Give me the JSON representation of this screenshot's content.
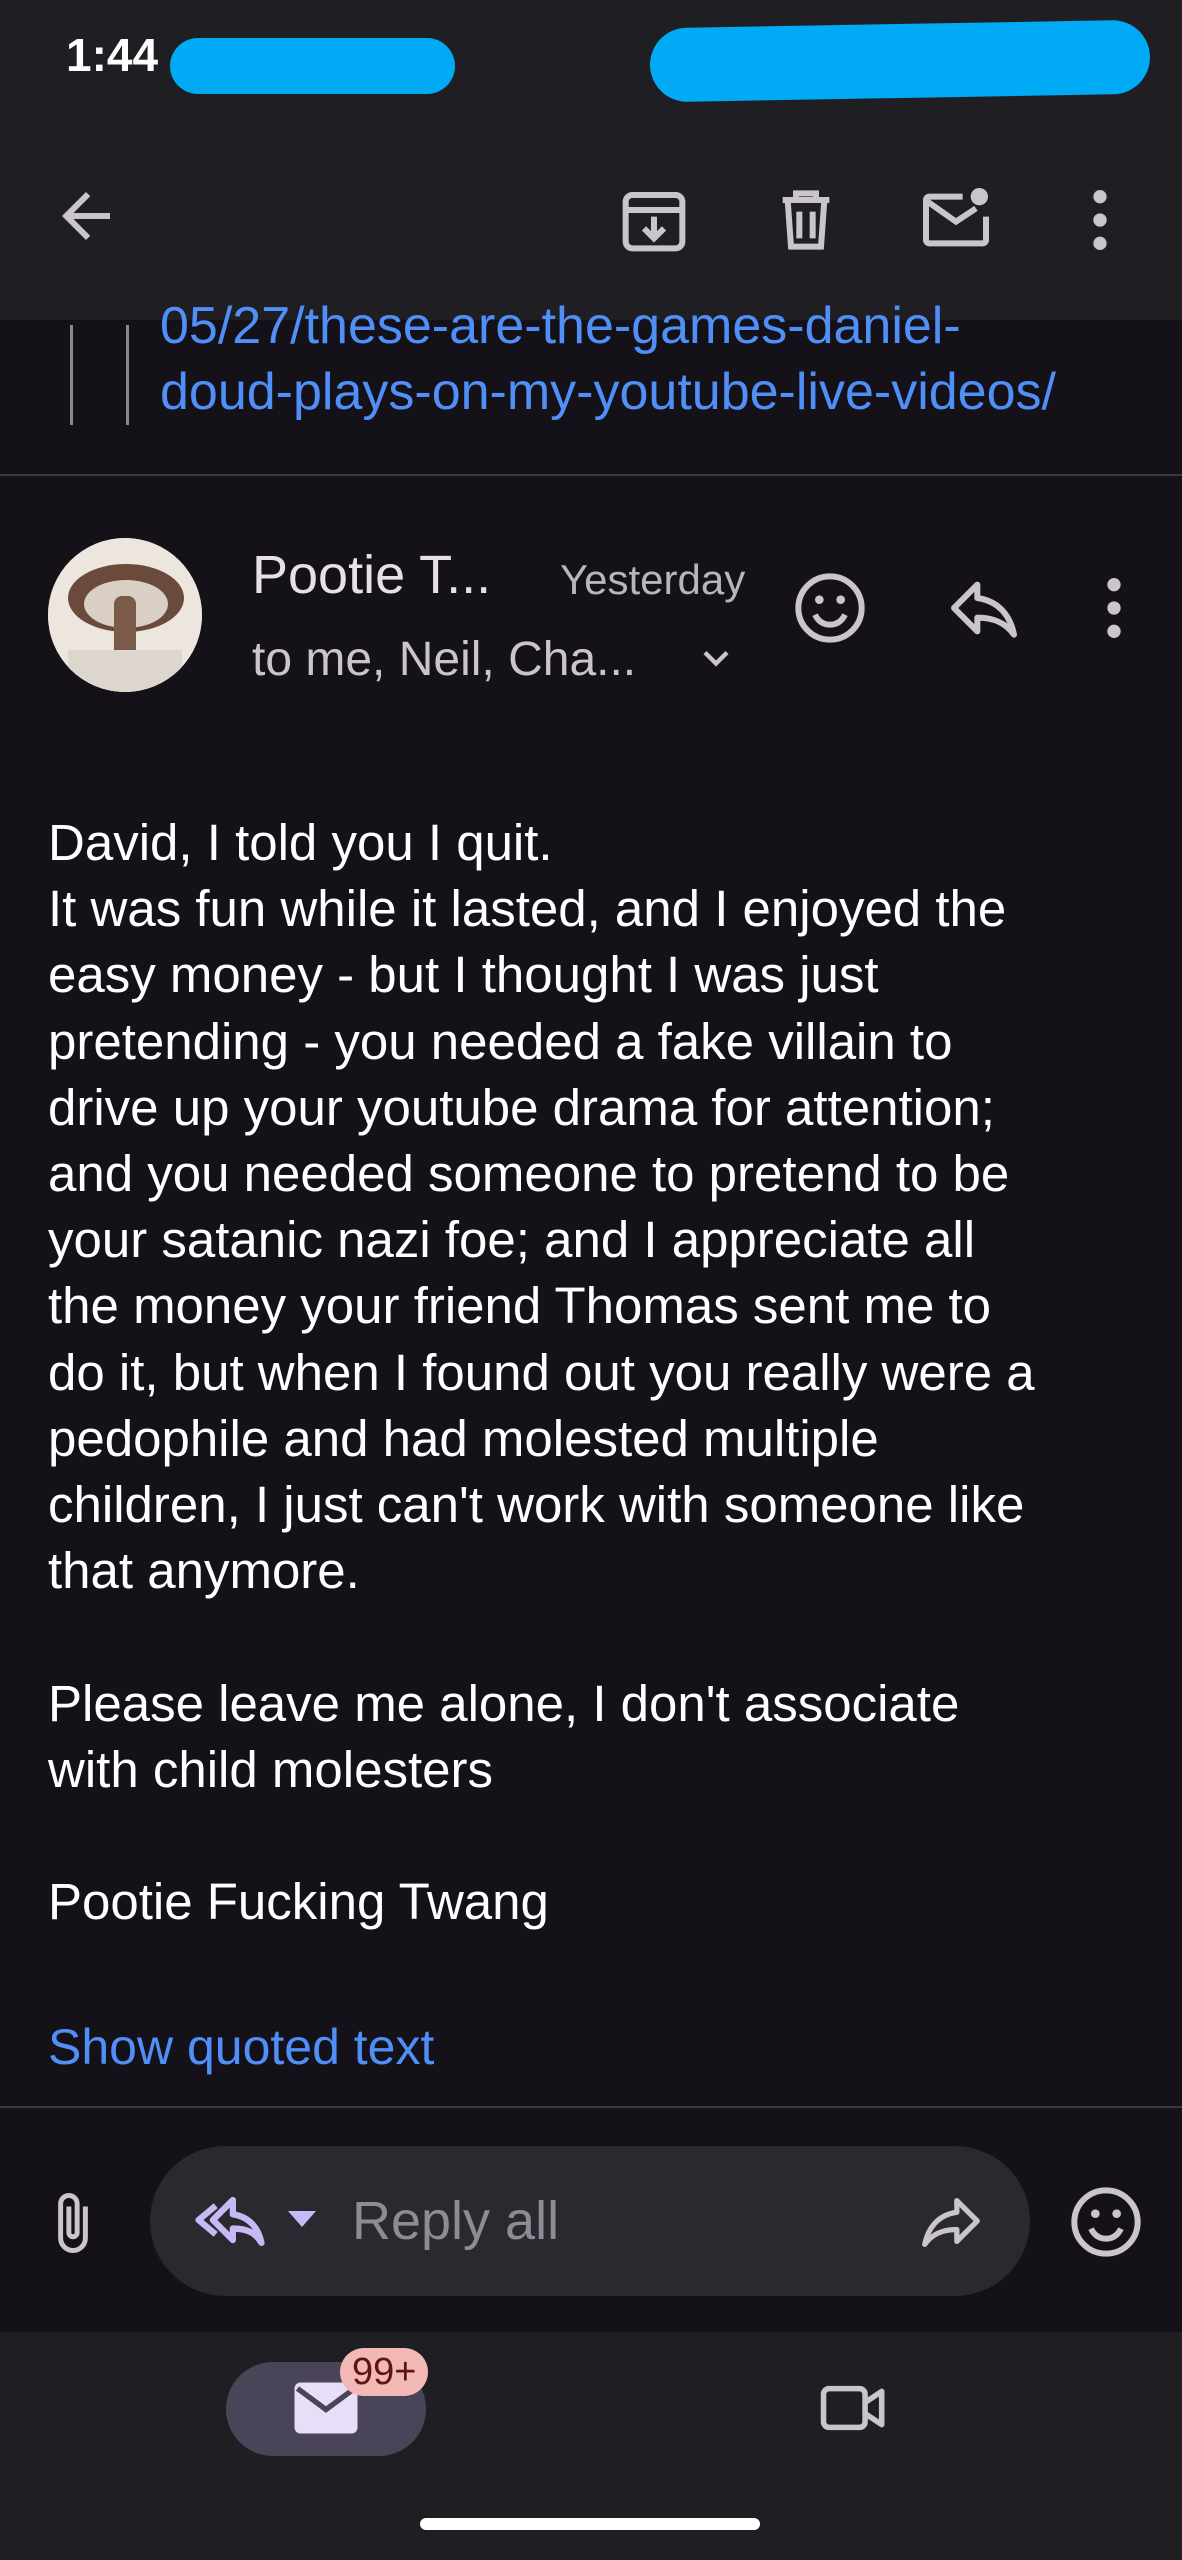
{
  "status_bar": {
    "time": "1:44"
  },
  "quoted_link": {
    "line1": "05/27/these-are-the-games-daniel-",
    "line2": "doud-plays-on-my-youtube-live-videos/"
  },
  "message": {
    "sender": "Pootie T...",
    "date": "Yesterday",
    "recipients": "to me, Neil, Cha...",
    "body": "David, I told you I quit.\nIt was fun while it lasted, and I enjoyed the\neasy money - but I thought I was just\npretending - you needed a fake villain to\ndrive up your youtube drama for attention;\nand you needed someone to pretend to be\nyour satanic nazi foe; and I appreciate all\nthe money your friend Thomas sent me to\ndo it, but when I found out you really were a\npedophile and had molested multiple\nchildren, I just can't work with someone like\nthat anymore.\n\nPlease leave me alone, I don't associate\nwith child molesters\n\nPootie Fucking Twang",
    "show_quoted": "Show quoted text"
  },
  "reply_bar": {
    "label": "Reply all"
  },
  "bottom_nav": {
    "mail_badge": "99+"
  },
  "colors": {
    "background": "#141218",
    "link": "#4f8ff7",
    "badge": "#f2b8b5"
  }
}
